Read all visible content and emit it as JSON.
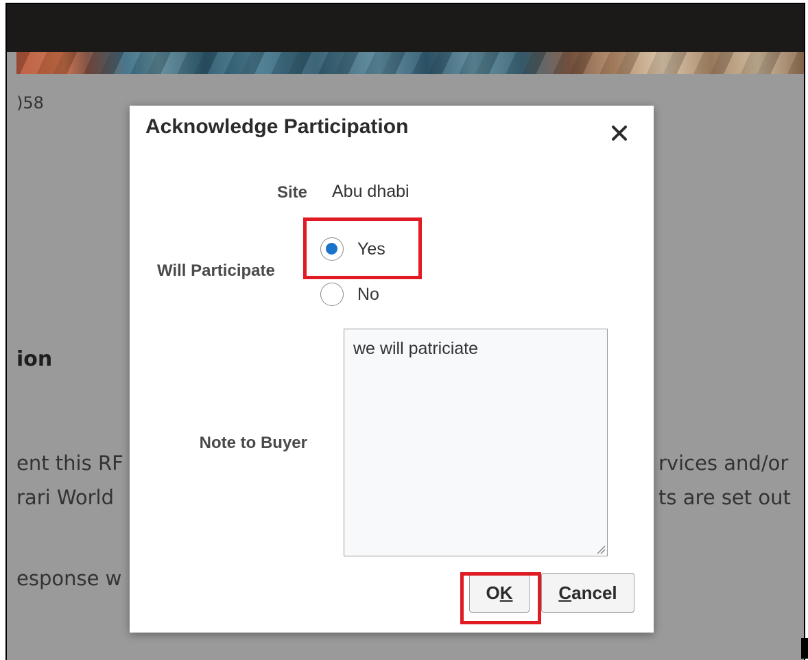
{
  "background": {
    "number_fragment": ")58",
    "heading_fragment": "ion",
    "lines": [
      {
        "left": "ent this RF",
        "right": "rvices and/or"
      },
      {
        "left": "rari World",
        "right": "ts are set out"
      },
      {
        "left": "esponse w",
        "right": ""
      }
    ]
  },
  "dialog": {
    "title": "Acknowledge Participation",
    "close_glyph": "×",
    "site": {
      "label": "Site",
      "value": "Abu dhabi"
    },
    "will_participate": {
      "label": "Will Participate",
      "options": [
        {
          "label": "Yes",
          "selected": true
        },
        {
          "label": "No",
          "selected": false
        }
      ]
    },
    "note_to_buyer": {
      "label": "Note to Buyer",
      "value": "we will patriciate"
    },
    "buttons": {
      "ok": {
        "pre": "O",
        "key": "K",
        "post": ""
      },
      "cancel": {
        "pre": "",
        "key": "C",
        "post": "ancel"
      }
    }
  },
  "colors": {
    "highlight": "#e01b24",
    "radio_selected": "#1a73c9",
    "overlay": "#9a9a9a",
    "top_bar": "#1b1a19"
  }
}
